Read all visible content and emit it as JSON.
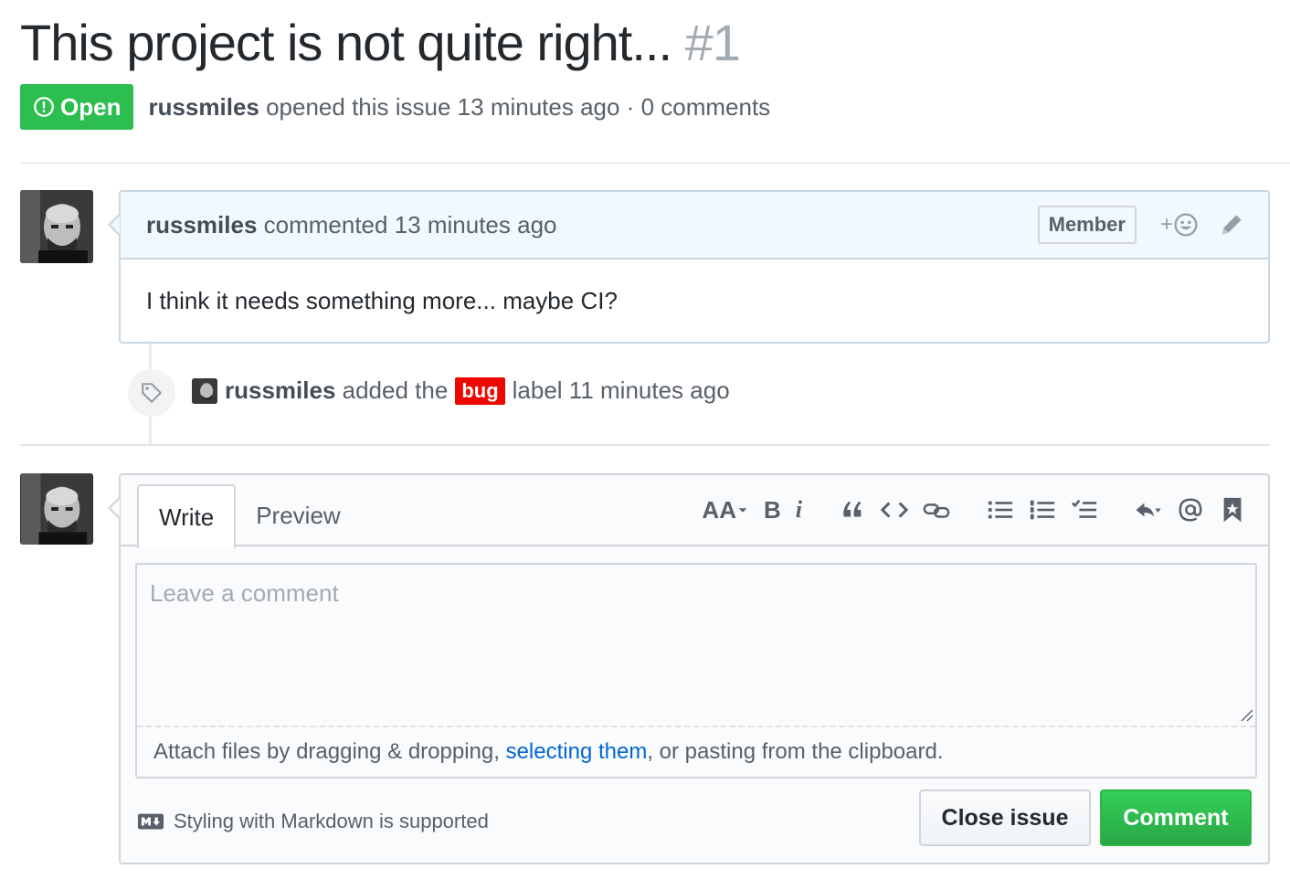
{
  "issue": {
    "title": "This project is not quite right...",
    "number": "#1",
    "state": "Open",
    "author": "russmiles",
    "opened_text": "opened this issue 13 minutes ago · 0 comments"
  },
  "comment": {
    "author": "russmiles",
    "meta": "commented 13 minutes ago",
    "role_badge": "Member",
    "reaction_plus": "+",
    "body": "I think it needs something more... maybe CI?"
  },
  "event": {
    "author": "russmiles",
    "prefix": "added the",
    "label": "bug",
    "label_color": "#ee0701",
    "suffix": "label 11 minutes ago"
  },
  "form": {
    "tabs": [
      {
        "label": "Write",
        "selected": true
      },
      {
        "label": "Preview",
        "selected": false
      }
    ],
    "toolbar": {
      "heading_icon_text": "AA",
      "bold_icon_text": "B",
      "italic_icon_text": "i",
      "icons": [
        "heading-icon",
        "bold-icon",
        "italic-icon",
        "quote-icon",
        "code-icon",
        "link-icon",
        "unordered-list-icon",
        "ordered-list-icon",
        "task-list-icon",
        "reply-icon",
        "mention-icon",
        "saved-reply-icon"
      ]
    },
    "placeholder": "Leave a comment",
    "attach_prefix": "Attach files by dragging & dropping, ",
    "attach_link": "selecting them",
    "attach_suffix": ", or pasting from the clipboard.",
    "markdown_note": "Styling with Markdown is supported",
    "close_button": "Close issue",
    "comment_button": "Comment"
  },
  "colors": {
    "open_green": "#2cbe4e",
    "link_blue": "#0366d6",
    "comment_header_bg": "#f1f8ff"
  }
}
